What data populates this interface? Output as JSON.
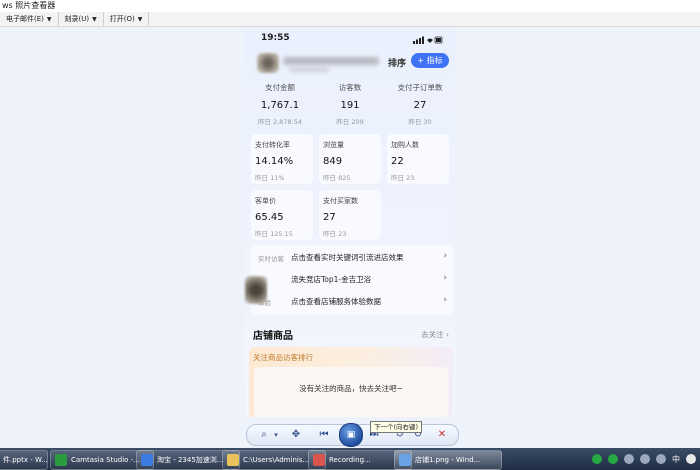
{
  "window": {
    "title": "ws 照片查看器",
    "menu": [
      {
        "label": "电子邮件(E)"
      },
      {
        "label": "刻录(U)"
      },
      {
        "label": "打开(O)"
      }
    ]
  },
  "phone": {
    "time": "19:55",
    "sort_label": "排序",
    "metric_button": "+ 指标",
    "top_stats": [
      {
        "label": "支付金额",
        "value": "1,767.1",
        "sub": "昨日 2,878.54"
      },
      {
        "label": "访客数",
        "value": "191",
        "sub": "昨日 209"
      },
      {
        "label": "支付子订单数",
        "value": "27",
        "sub": "昨日 30"
      }
    ],
    "cards": [
      {
        "label": "支付转化率",
        "value": "14.14%",
        "sub": "昨日 11%"
      },
      {
        "label": "浏览量",
        "value": "849",
        "sub": "昨日 825"
      },
      {
        "label": "加购人数",
        "value": "22",
        "sub": "昨日 23"
      },
      {
        "label": "客单价",
        "value": "65.45",
        "sub": "昨日 125.15"
      },
      {
        "label": "支付买家数",
        "value": "27",
        "sub": "昨日 23"
      }
    ],
    "links": [
      {
        "tag": "实时访客",
        "text": "点击查看实时关键词引流进店效果"
      },
      {
        "tag": "",
        "text": "流失竞店Top1-金吉卫浴"
      },
      {
        "tag": "体验",
        "text": "点击查看店铺服务体验数据"
      }
    ],
    "goods_title": "店铺商品",
    "goods_follow": "去关注",
    "attention_title": "关注商品访客排行",
    "attention_empty": "没有关注的商品，快去关注吧~"
  },
  "toolbar": {
    "tooltip": "下一个(向右键)",
    "zoom_icon": "magnifier-icon",
    "fit_icon": "fit-icon",
    "prev_icon": "previous-icon",
    "slideshow_icon": "slideshow-icon",
    "next_icon": "next-icon",
    "rotate_ccw_icon": "rotate-left-icon",
    "rotate_cw_icon": "rotate-right-icon",
    "delete_icon": "delete-icon"
  },
  "taskbar": {
    "tasks": [
      {
        "label": "件.pptx - W..."
      },
      {
        "label": "Camtasia Studio -..."
      },
      {
        "label": "淘宝 - 2345加速浏..."
      },
      {
        "label": "C:\\Users\\Adminis..."
      },
      {
        "label": "Recording..."
      },
      {
        "label": "店铺1.png - Wind..."
      }
    ],
    "ime": "中"
  }
}
